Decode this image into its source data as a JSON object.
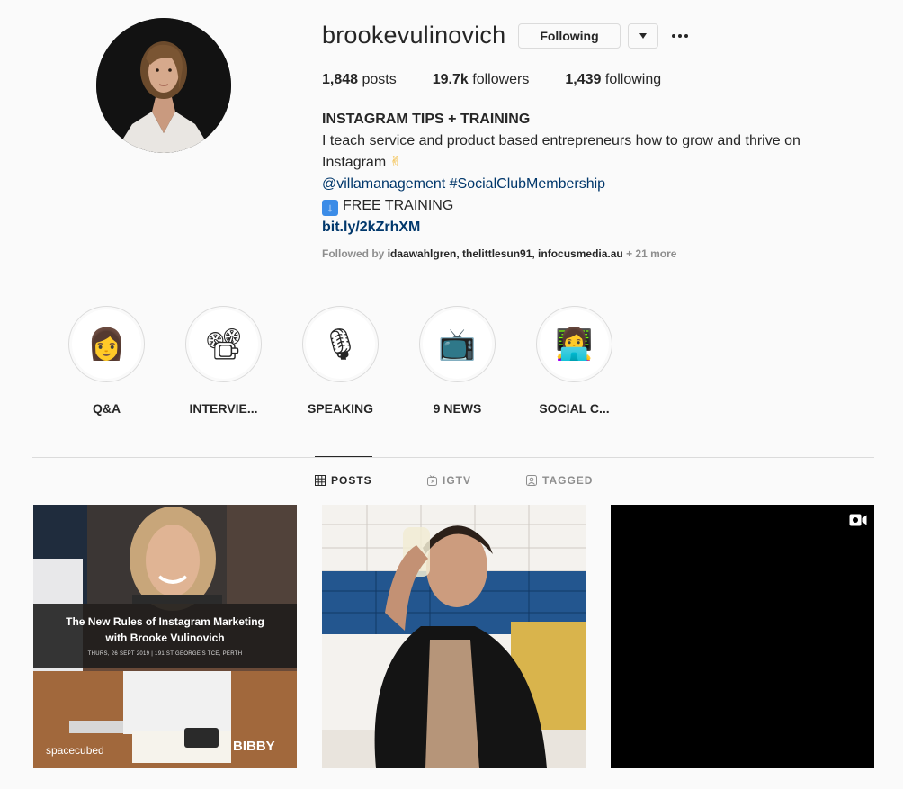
{
  "profile": {
    "username": "brookevulinovich",
    "following_label": "Following",
    "avatar_icon": "avatar-photo",
    "stats": {
      "posts_count": "1,848",
      "posts_label": "posts",
      "followers_count": "19.7k",
      "followers_label": "followers",
      "following_count": "1,439",
      "following_label": "following"
    },
    "bio": {
      "full_name": "INSTAGRAM TIPS + TRAINING",
      "line1": "I teach service and product based entrepreneurs how to grow and thrive on",
      "line2": "Instagram",
      "mention": "@villamanagement",
      "hashtag": "#SocialClubMembership",
      "training": "FREE TRAINING",
      "url": "bit.ly/2kZrhXM"
    },
    "followed_by": {
      "prefix": "Followed by",
      "names": "idaawahlgren, thelittlesun91, infocusmedia.au",
      "more": "+ 21 more"
    }
  },
  "highlights": [
    {
      "label": "Q&A",
      "icon": "woman-emoji"
    },
    {
      "label": "INTERVIE...",
      "icon": "film-projector-emoji"
    },
    {
      "label": "SPEAKING",
      "icon": "microphone-emoji"
    },
    {
      "label": "9 NEWS",
      "icon": "television-emoji"
    },
    {
      "label": "SOCIAL C...",
      "icon": "technologist-emoji"
    }
  ],
  "tabs": [
    {
      "label": "POSTS",
      "icon": "grid-icon",
      "active": true
    },
    {
      "label": "IGTV",
      "icon": "igtv-icon",
      "active": false
    },
    {
      "label": "TAGGED",
      "icon": "tagged-icon",
      "active": false
    }
  ],
  "posts": [
    {
      "type": "image",
      "title_line1": "The New Rules of Instagram Marketing",
      "title_line2": "with Brooke Vulinovich",
      "subtitle": "THURS, 26 SEPT 2019 | 191 ST GEORGE'S TCE, PERTH",
      "brand_left": "spacecubed",
      "brand_right": "BIBBY"
    },
    {
      "type": "image"
    },
    {
      "type": "video"
    }
  ],
  "colors": {
    "link": "#00376b",
    "muted": "#8e8e8e",
    "border": "#dbdbdb",
    "text": "#262626"
  }
}
